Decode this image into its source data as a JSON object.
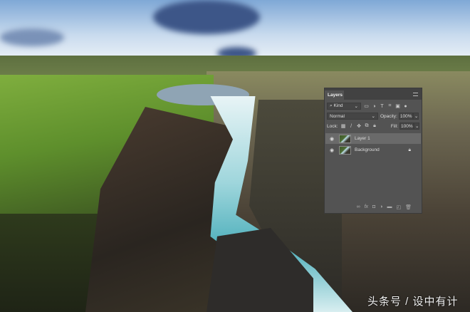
{
  "watermark": "头条号 / 设中有计",
  "layers_panel": {
    "tab_label": "Layers",
    "filter_kind": "Kind",
    "blend_mode": "Normal",
    "opacity_label": "Opacity:",
    "opacity_value": "100%",
    "lock_label": "Lock:",
    "fill_label": "Fill:",
    "fill_value": "100%",
    "layers": [
      {
        "name": "Layer 1",
        "selected": true,
        "visible": true
      },
      {
        "name": "Background",
        "selected": false,
        "visible": true,
        "locked": true
      }
    ],
    "bottom_icons": [
      "link-icon",
      "fx-icon",
      "mask-icon",
      "adjustment-icon",
      "folder-icon",
      "new-layer-icon",
      "trash-icon"
    ]
  }
}
